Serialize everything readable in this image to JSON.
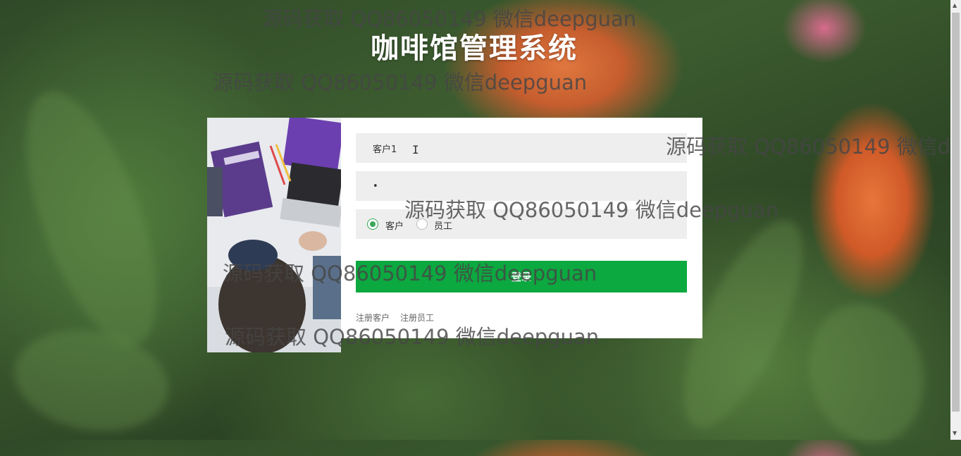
{
  "title": "咖啡馆管理系统",
  "form": {
    "username_value": "客户1",
    "password_value": "•",
    "role_options": [
      "客户",
      "员工"
    ],
    "selected_role": "客户",
    "login_label": "登录",
    "register_links": [
      "注册客户",
      "注册员工"
    ]
  },
  "watermark_text": "源码获取 QQ86050149 微信deepguan",
  "colors": {
    "login_button": "#0ca840",
    "radio_selected": "#3aa65a",
    "field_bg": "#eeeeee"
  }
}
